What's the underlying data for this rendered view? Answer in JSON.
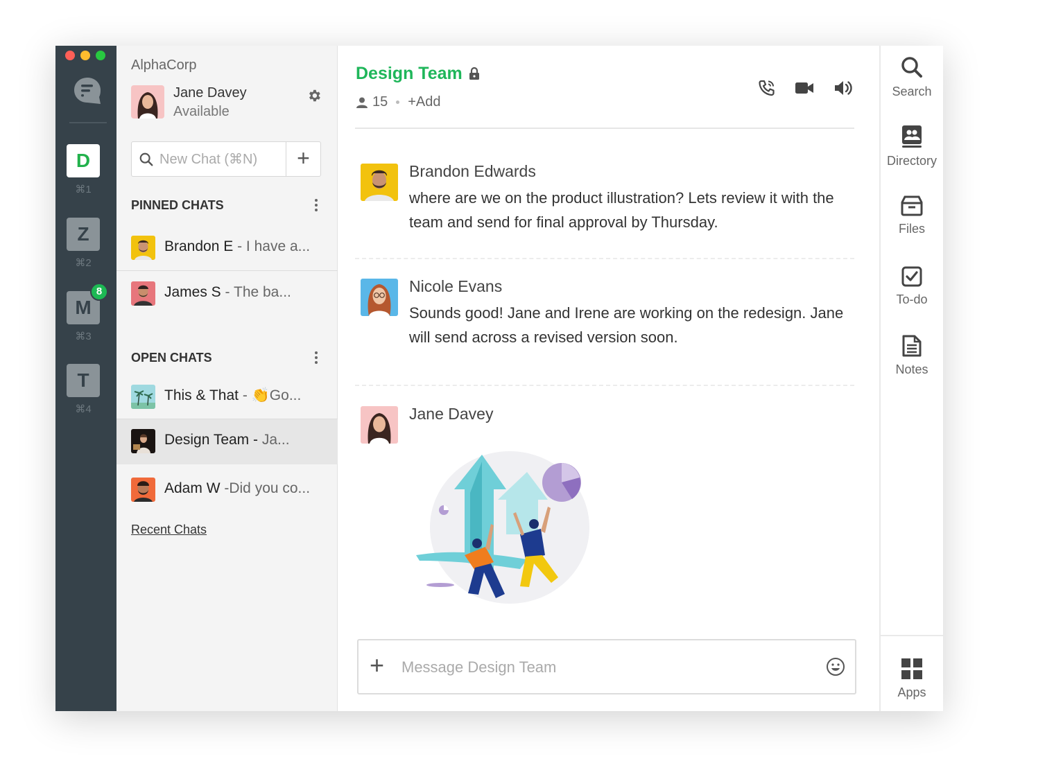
{
  "window": {
    "traffic_lights": {
      "close": "#ff5f57",
      "minimize": "#febc2e",
      "zoom": "#28c840"
    }
  },
  "workspaces": [
    {
      "letter": "D",
      "shortcut": "⌘1",
      "active": true
    },
    {
      "letter": "Z",
      "shortcut": "⌘2",
      "active": false
    },
    {
      "letter": "M",
      "shortcut": "⌘3",
      "active": false,
      "badge": "8"
    },
    {
      "letter": "T",
      "shortcut": "⌘4",
      "active": false
    }
  ],
  "sidebar": {
    "org_name": "AlphaCorp",
    "user": {
      "name": "Jane Davey",
      "status": "Available"
    },
    "new_chat_placeholder": "New Chat (⌘N)",
    "pinned_title": "PINNED CHATS",
    "pinned": [
      {
        "name": "Brandon E",
        "preview": " - I have a..."
      },
      {
        "name": "James S",
        "preview": "  - The ba..."
      }
    ],
    "open_title": "OPEN CHATS",
    "open": [
      {
        "name": "This & That",
        "preview": " - 👏Go..."
      },
      {
        "name": "Design Team -",
        "preview": " Ja..."
      },
      {
        "name": "Adam W",
        "preview": " -Did you co..."
      }
    ],
    "recent_link": "Recent Chats"
  },
  "channel": {
    "title": "Design Team",
    "member_count": "15",
    "add_label": "+Add",
    "accent": "#1fb65a"
  },
  "messages": [
    {
      "author": "Brandon Edwards",
      "text": "where are we on the product illustration? Lets review it with the team and send for final approval by Thursday."
    },
    {
      "author": "Nicole Evans",
      "text": "Sounds good! Jane and Irene are working on the redesign. Jane will send across a revised version soon."
    },
    {
      "author": "Jane Davey",
      "text": ""
    }
  ],
  "composer": {
    "placeholder": "Message Design Team"
  },
  "right_rail": [
    {
      "label": "Search",
      "icon": "search-icon"
    },
    {
      "label": "Directory",
      "icon": "directory-icon"
    },
    {
      "label": "Files",
      "icon": "files-icon"
    },
    {
      "label": "To-do",
      "icon": "todo-icon"
    },
    {
      "label": "Notes",
      "icon": "notes-icon"
    },
    {
      "label": "Apps",
      "icon": "apps-icon"
    }
  ]
}
